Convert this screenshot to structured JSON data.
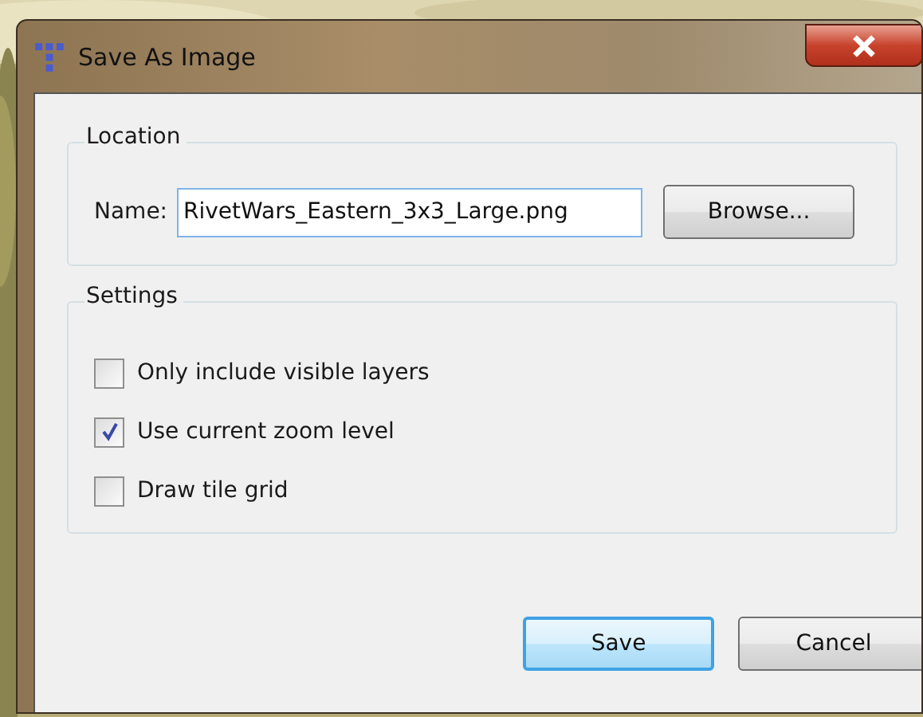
{
  "window": {
    "title": "Save As Image"
  },
  "location": {
    "title": "Location",
    "name_label": "Name:",
    "name_value": "RivetWars_Eastern_3x3_Large.png",
    "browse": "Browse..."
  },
  "settings": {
    "title": "Settings",
    "options": [
      {
        "label": "Only include visible layers",
        "checked": false
      },
      {
        "label": "Use current zoom level",
        "checked": true
      },
      {
        "label": "Draw tile grid",
        "checked": false
      }
    ]
  },
  "buttons": [
    {
      "label": "Save",
      "default": true
    },
    {
      "label": "Cancel",
      "default": false
    }
  ]
}
